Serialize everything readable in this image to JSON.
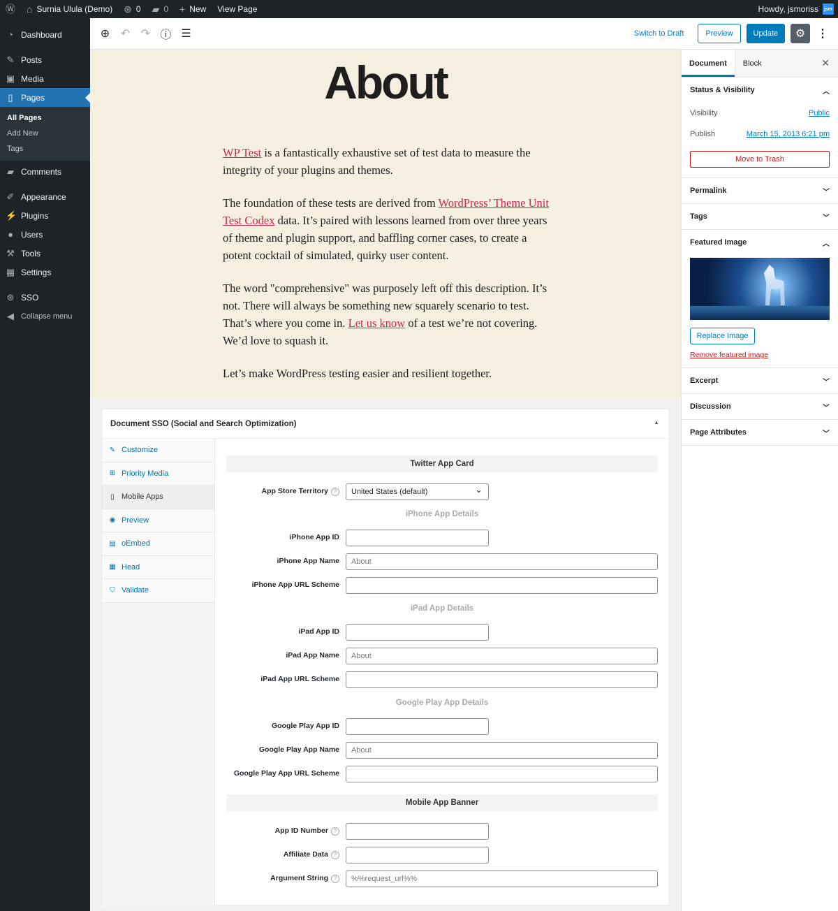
{
  "adminbar": {
    "site_name": "Surnia Ulula (Demo)",
    "updates_count": "0",
    "comments_count": "0",
    "new_label": "New",
    "view_page_label": "View Page",
    "howdy": "Howdy, jsmoriss",
    "avatar_initials": "jsm"
  },
  "menu": {
    "dashboard": "Dashboard",
    "posts": "Posts",
    "media": "Media",
    "pages": "Pages",
    "all_pages": "All Pages",
    "add_new": "Add New",
    "tags": "Tags",
    "comments": "Comments",
    "appearance": "Appearance",
    "plugins": "Plugins",
    "users": "Users",
    "tools": "Tools",
    "settings": "Settings",
    "sso": "SSO",
    "collapse": "Collapse menu"
  },
  "toolbar": {
    "switch_to_draft": "Switch to Draft",
    "preview": "Preview",
    "update": "Update"
  },
  "content": {
    "title": "About",
    "p1_link": "WP Test",
    "p1_rest": " is a fantastically exhaustive set of test data to measure the integrity of your plugins and themes.",
    "p2_start": "The foundation of these tests are derived from ",
    "p2_link": "WordPress’ Theme Unit Test Codex",
    "p2_rest": " data. It’s paired with lessons learned from over three years of theme and plugin support, and baffling corner cases, to create a potent cocktail of simulated, quirky user content.",
    "p3_start": "The word \"comprehensive\" was purposely left off this description. It’s not. There will always be something new squarely scenario to test. That’s where you come in. ",
    "p3_link": "Let us know",
    "p3_rest": " of a test we’re not covering. We’d love to squash it.",
    "p4": "Let’s make WordPress testing easier and resilient together."
  },
  "meta": {
    "title": "Document SSO (Social and Search Optimization)",
    "tabs": [
      "Customize",
      "Priority Media",
      "Mobile Apps",
      "Preview",
      "oEmbed",
      "Head",
      "Validate"
    ],
    "twitter_card": "Twitter App Card",
    "app_store_territory": "App Store Territory",
    "territory_value": "United States (default)",
    "iphone_details": "iPhone App Details",
    "iphone_id": "iPhone App ID",
    "iphone_name": "iPhone App Name",
    "iphone_name_ph": "About",
    "iphone_url": "iPhone App URL Scheme",
    "ipad_details": "iPad App Details",
    "ipad_id": "iPad App ID",
    "ipad_name": "iPad App Name",
    "ipad_name_ph": "About",
    "ipad_url": "iPad App URL Scheme",
    "gplay_details": "Google Play App Details",
    "gplay_id": "Google Play App ID",
    "gplay_name": "Google Play App Name",
    "gplay_name_ph": "About",
    "gplay_url": "Google Play App URL Scheme",
    "banner": "Mobile App Banner",
    "app_id_number": "App ID Number",
    "affiliate_data": "Affiliate Data",
    "argument_string": "Argument String",
    "argument_string_ph": "%%request_url%%",
    "help_glyph": "?"
  },
  "sidebar": {
    "tab_document": "Document",
    "tab_block": "Block",
    "status_visibility": "Status & Visibility",
    "visibility_label": "Visibility",
    "visibility_value": "Public",
    "publish_label": "Publish",
    "publish_value": "March 15, 2013 6:21 pm",
    "move_to_trash": "Move to Trash",
    "permalink": "Permalink",
    "tags": "Tags",
    "featured_image": "Featured Image",
    "replace_image": "Replace Image",
    "remove_image": "Remove featured image",
    "excerpt": "Excerpt",
    "discussion": "Discussion",
    "page_attributes": "Page Attributes"
  },
  "colors": {
    "admin_dark": "#1d2327",
    "accent": "#007cba",
    "content_bg": "#f5efe0",
    "link": "#cd2653",
    "danger": "#cc1818"
  },
  "icons": [
    "wordpress-icon",
    "home-icon",
    "updates-icon",
    "comment-icon",
    "plus-icon",
    "dashboard-icon",
    "pin-icon",
    "media-icon",
    "pages-icon",
    "appearance-icon",
    "plugins-icon",
    "users-icon",
    "tools-icon",
    "settings-icon",
    "sso-icon",
    "collapse-icon",
    "add-block-icon",
    "undo-icon",
    "redo-icon",
    "info-icon",
    "list-view-icon",
    "gear-icon",
    "more-icon",
    "close-icon",
    "chevron-up-icon",
    "chevron-down-icon"
  ]
}
